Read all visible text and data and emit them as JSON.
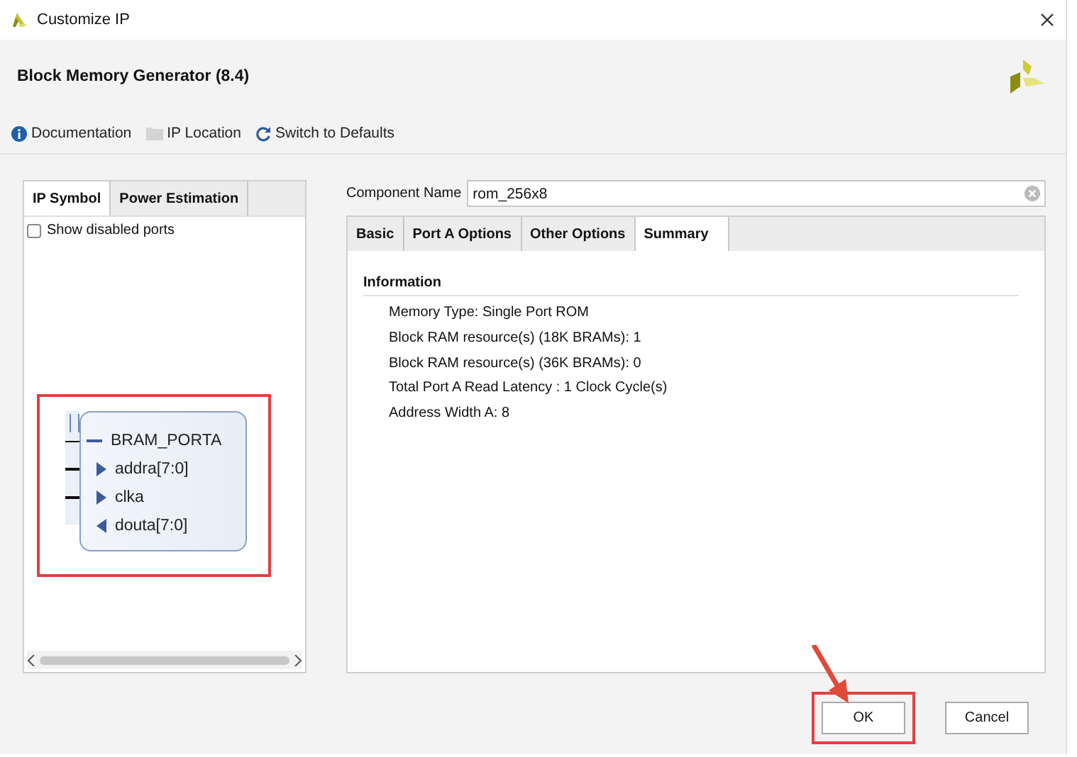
{
  "window": {
    "title": "Customize IP"
  },
  "header": {
    "title": "Block Memory Generator (8.4)"
  },
  "toolbar": [
    {
      "label": "Documentation",
      "kind": "info"
    },
    {
      "label": "IP Location",
      "kind": "folder"
    },
    {
      "label": "Switch to Defaults",
      "kind": "refresh"
    }
  ],
  "left_panel": {
    "tabs": [
      {
        "label": "IP Symbol",
        "selected": true
      },
      {
        "label": "Power Estimation",
        "selected": false
      }
    ],
    "show_disabled_ports": {
      "label": "Show disabled ports",
      "checked": false
    },
    "symbol": {
      "highlighted": true,
      "interface": "BRAM_PORTA",
      "ports": [
        {
          "name": "addra[7:0]",
          "kind": "input"
        },
        {
          "name": "clka",
          "kind": "input"
        },
        {
          "name": "douta[7:0]",
          "kind": "output"
        }
      ]
    }
  },
  "component_name": {
    "label": "Component Name",
    "value": "rom_256x8"
  },
  "config_tabs": [
    {
      "label": "Basic",
      "selected": false
    },
    {
      "label": "Port A Options",
      "selected": false
    },
    {
      "label": "Other Options",
      "selected": false
    },
    {
      "label": "Summary",
      "selected": true
    }
  ],
  "summary": {
    "heading": "Information",
    "lines": [
      "Memory Type: Single Port ROM",
      "Block RAM resource(s) (18K BRAMs): 1",
      "Block RAM resource(s) (36K BRAMs): 0",
      "Total Port A Read Latency : 1 Clock Cycle(s)",
      "Address Width A: 8"
    ]
  },
  "buttons": [
    {
      "label": "OK",
      "highlighted": true
    },
    {
      "label": "Cancel",
      "highlighted": false
    }
  ]
}
